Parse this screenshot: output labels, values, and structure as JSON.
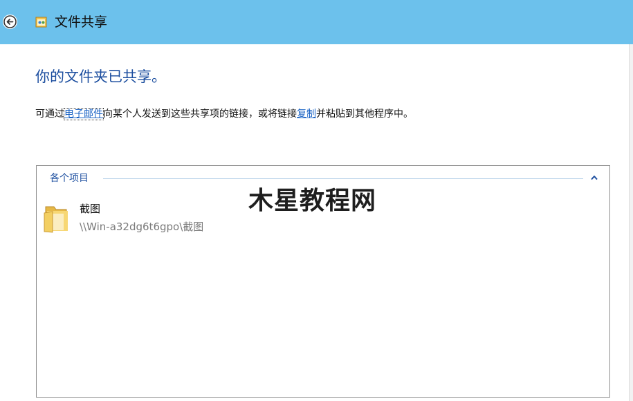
{
  "window": {
    "title": "文件共享",
    "back_icon": "back-arrow-icon",
    "app_icon": "file-share-icon"
  },
  "main": {
    "heading": "你的文件夹已共享。",
    "description": {
      "part1": "可通过",
      "link_email": "电子邮件",
      "part2": "向某个人发送到这些共享项的链接，或将链接",
      "link_copy": "复制",
      "part3": "并粘贴到其他程序中。"
    }
  },
  "items_group": {
    "label": "各个项目",
    "collapse_icon": "chevron-up-icon",
    "items": [
      {
        "name": "截图",
        "path": "\\\\Win-a32dg6t6gpo\\截图",
        "icon": "folder-icon"
      }
    ]
  },
  "watermark": "木星教程网",
  "colors": {
    "titlebar_bg": "#6cc1ec",
    "heading": "#1c4e9f",
    "link": "#1a63c5",
    "path_text": "#7a7a7a"
  }
}
